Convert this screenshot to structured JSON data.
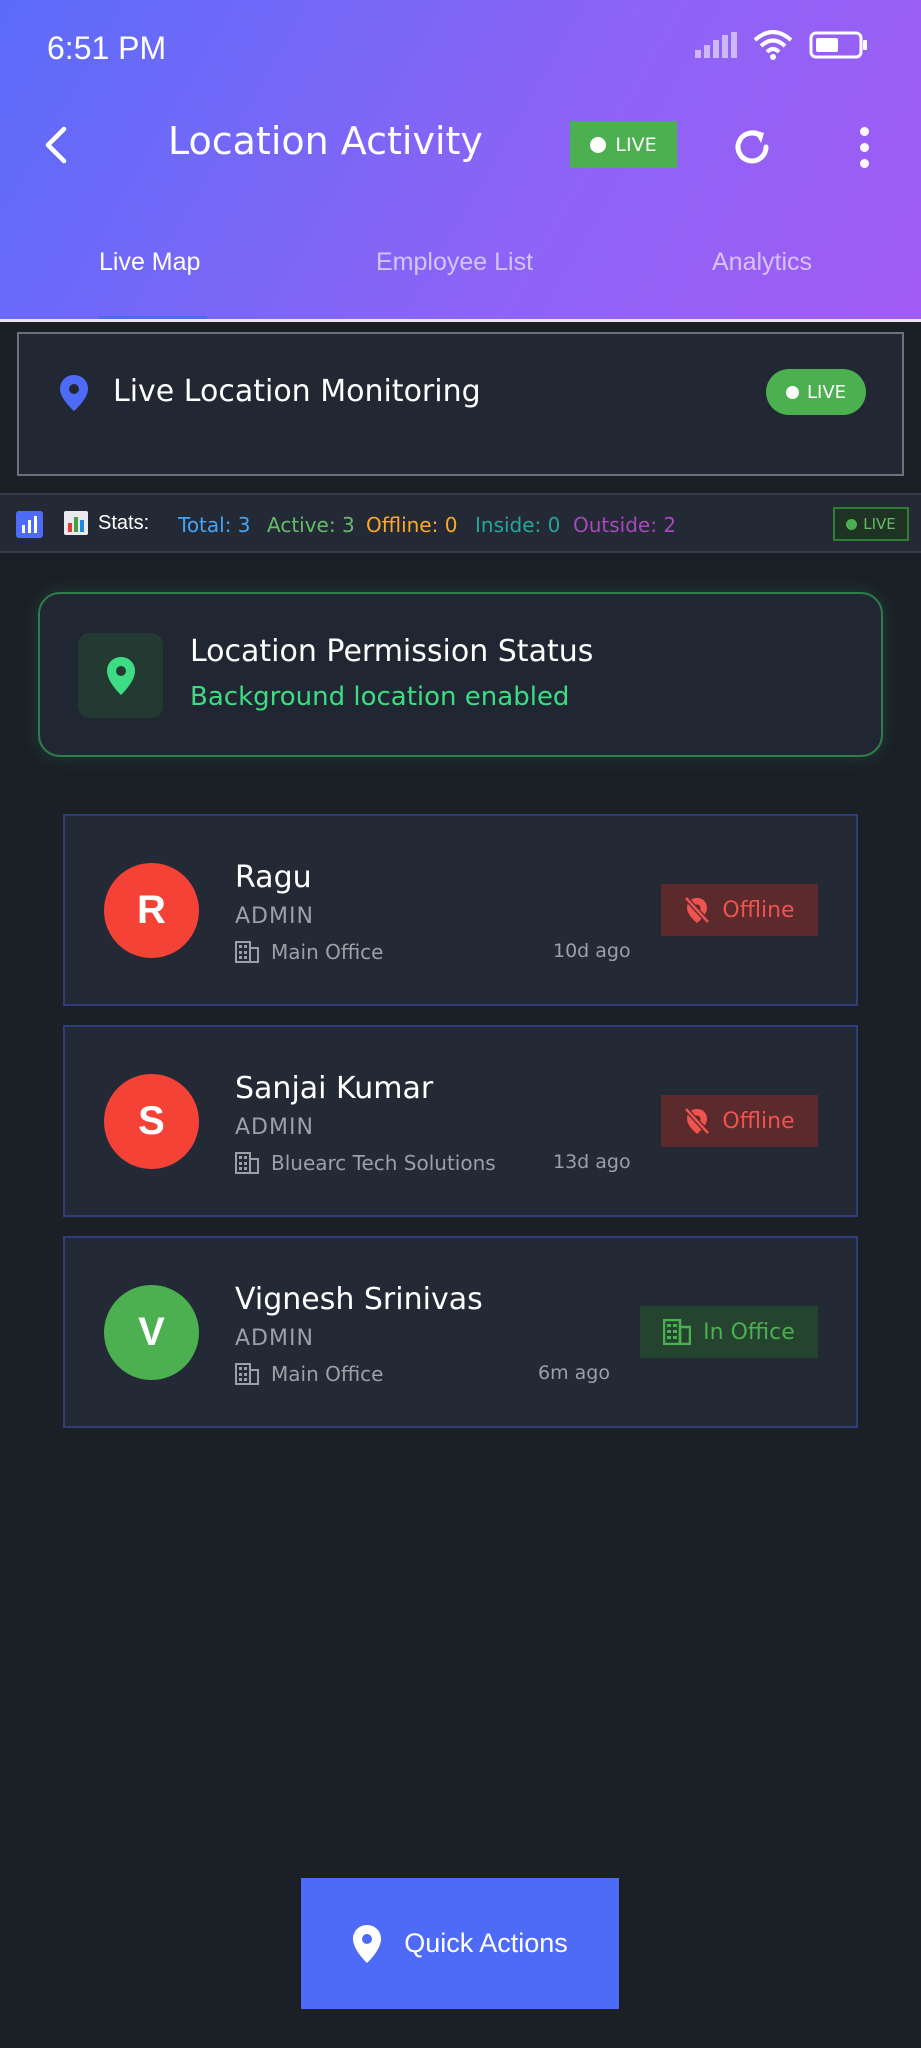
{
  "status_bar": {
    "time": "6:51 PM"
  },
  "appbar": {
    "title": "Location Activity",
    "live_label": "LIVE"
  },
  "tabs": [
    {
      "label": "Live Map",
      "active": true
    },
    {
      "label": "Employee List",
      "active": false
    },
    {
      "label": "Analytics",
      "active": false
    }
  ],
  "monitor": {
    "label": "Live Location Monitoring",
    "live_label": "LIVE"
  },
  "stats": {
    "label": "Stats:",
    "total": "Total: 3",
    "active": "Active: 3",
    "offline": "Offline: 0",
    "inside": "Inside: 0",
    "outside": "Outside: 2",
    "live_label": "LIVE"
  },
  "permission": {
    "title": "Location Permission Status",
    "subtitle": "Background location enabled"
  },
  "employees": [
    {
      "initial": "R",
      "name": "Ragu",
      "role": "ADMIN",
      "office": "Main Office",
      "ago": "10d ago",
      "status": "Offline",
      "avatar_color": "#f44336"
    },
    {
      "initial": "S",
      "name": "Sanjai Kumar",
      "role": "ADMIN",
      "office": "Bluearc Tech Solutions",
      "ago": "13d ago",
      "status": "Offline",
      "avatar_color": "#f44336"
    },
    {
      "initial": "V",
      "name": "Vignesh Srinivas",
      "role": "ADMIN",
      "office": "Main Office",
      "ago": "6m ago",
      "status": "In Office",
      "avatar_color": "#4caf50"
    }
  ],
  "quick_actions": {
    "label": "Quick Actions"
  },
  "colors": {
    "accent": "#4e6bf7",
    "live_green": "#4caf50",
    "offline_red": "#ef5350"
  }
}
